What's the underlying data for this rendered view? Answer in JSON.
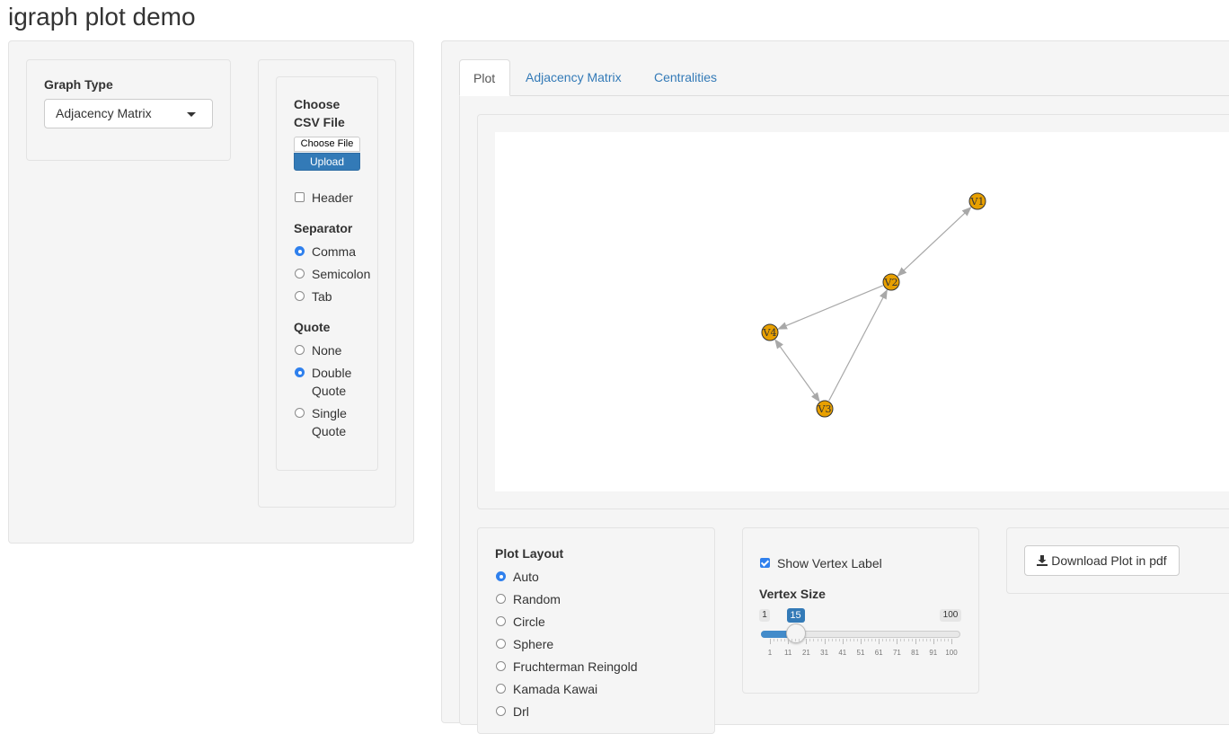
{
  "app": {
    "title": "igraph plot demo"
  },
  "graph_type": {
    "label": "Graph Type",
    "selected": "Adjacency Matrix"
  },
  "file_input": {
    "label_line1": "Choose",
    "label_line2": "CSV File",
    "choose_button": "Choose File",
    "upload_button": "Upload"
  },
  "header_option": {
    "label": "Header",
    "checked": false
  },
  "separator": {
    "label": "Separator",
    "options": [
      "Comma",
      "Semicolon",
      "Tab"
    ],
    "selected": "Comma"
  },
  "quote": {
    "label": "Quote",
    "options": [
      {
        "line1": "None",
        "line2": ""
      },
      {
        "line1": "Double",
        "line2": "Quote"
      },
      {
        "line1": "Single",
        "line2": "Quote"
      }
    ],
    "selected": "Double Quote"
  },
  "tabs": {
    "items": [
      "Plot",
      "Adjacency Matrix",
      "Centralities"
    ],
    "active": "Plot"
  },
  "graph": {
    "vertex_color": "#e8a000",
    "edge_color": "#a8a8a8",
    "vertices": [
      "V1",
      "V2",
      "V3",
      "V4"
    ],
    "edges": [
      {
        "from": "V1",
        "to": "V2",
        "arrow": "both"
      },
      {
        "from": "V2",
        "to": "V4",
        "arrow": "to"
      },
      {
        "from": "V3",
        "to": "V2",
        "arrow": "to"
      },
      {
        "from": "V4",
        "to": "V3",
        "arrow": "both"
      }
    ]
  },
  "plot_layout": {
    "label": "Plot Layout",
    "options": [
      "Auto",
      "Random",
      "Circle",
      "Sphere",
      "Fruchterman Reingold",
      "Kamada Kawai",
      "Drl"
    ],
    "selected": "Auto"
  },
  "vertex_options": {
    "show_label_text": "Show Vertex Label",
    "show_label_checked": true,
    "size_label": "Vertex Size",
    "min": "1",
    "max": "100",
    "value": "15",
    "value_fraction": 0.1414,
    "ticks": [
      "1",
      "11",
      "21",
      "31",
      "41",
      "51",
      "61",
      "71",
      "81",
      "91",
      "100"
    ]
  },
  "download": {
    "label": "Download Plot in pdf"
  },
  "colors": {
    "accent": "#2f80ed",
    "upload_bg": "#337ab7",
    "link": "#337ab7"
  }
}
